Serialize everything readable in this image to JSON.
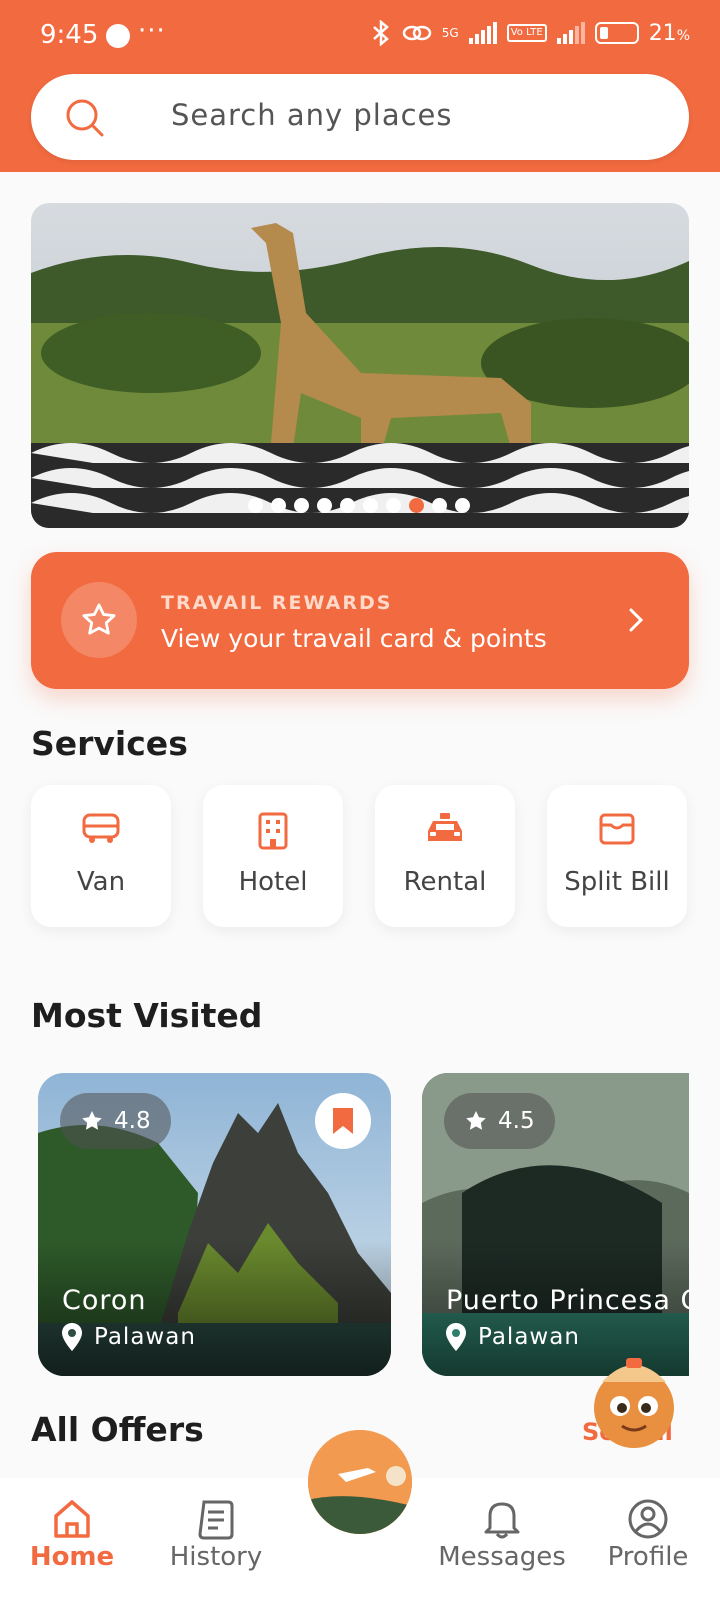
{
  "status_bar": {
    "time": "9:45",
    "more": "···",
    "network": "5G",
    "lte": "Vo LTE",
    "battery": "21",
    "battery_unit": "%"
  },
  "search": {
    "placeholder": "Search any places",
    "icon": "search-icon"
  },
  "banner": {
    "slide_count": 10,
    "active_slide": 8
  },
  "rewards": {
    "label": "TRAVAIL REWARDS",
    "subtitle": "View your travail card & points",
    "icon": "star-icon"
  },
  "services": {
    "title": "Services",
    "items": [
      {
        "label": "Van",
        "icon": "van-icon"
      },
      {
        "label": "Hotel",
        "icon": "hotel-icon"
      },
      {
        "label": "Rental",
        "icon": "car-icon"
      },
      {
        "label": "Split Bill",
        "icon": "wallet-icon"
      }
    ]
  },
  "most_visited": {
    "title": "Most Visited",
    "items": [
      {
        "name": "Coron",
        "location": "Palawan",
        "rating": "4.8",
        "bookmarked": true
      },
      {
        "name": "Puerto Princesa C",
        "location": "Palawan",
        "rating": "4.5",
        "bookmarked": false
      }
    ]
  },
  "all_offers": {
    "title": "All Offers",
    "see_all": "See all"
  },
  "nav": {
    "items": [
      {
        "label": "Home",
        "icon": "home-icon",
        "active": true
      },
      {
        "label": "History",
        "icon": "history-icon",
        "active": false
      },
      {
        "label": "Messages",
        "icon": "bell-icon",
        "active": false
      },
      {
        "label": "Profile",
        "icon": "profile-icon",
        "active": false
      }
    ]
  },
  "colors": {
    "accent": "#f26a3f",
    "background": "#fafafa"
  }
}
